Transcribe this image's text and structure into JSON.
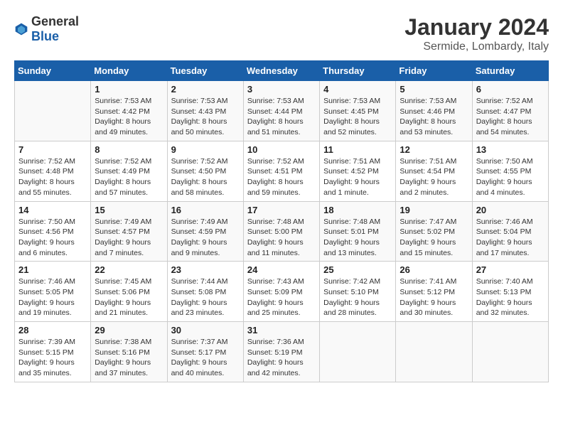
{
  "header": {
    "logo": {
      "general": "General",
      "blue": "Blue"
    },
    "month": "January 2024",
    "location": "Sermide, Lombardy, Italy"
  },
  "columns": [
    "Sunday",
    "Monday",
    "Tuesday",
    "Wednesday",
    "Thursday",
    "Friday",
    "Saturday"
  ],
  "weeks": [
    [
      {
        "day": "",
        "sunrise": "",
        "sunset": "",
        "daylight": ""
      },
      {
        "day": "1",
        "sunrise": "Sunrise: 7:53 AM",
        "sunset": "Sunset: 4:42 PM",
        "daylight": "Daylight: 8 hours and 49 minutes."
      },
      {
        "day": "2",
        "sunrise": "Sunrise: 7:53 AM",
        "sunset": "Sunset: 4:43 PM",
        "daylight": "Daylight: 8 hours and 50 minutes."
      },
      {
        "day": "3",
        "sunrise": "Sunrise: 7:53 AM",
        "sunset": "Sunset: 4:44 PM",
        "daylight": "Daylight: 8 hours and 51 minutes."
      },
      {
        "day": "4",
        "sunrise": "Sunrise: 7:53 AM",
        "sunset": "Sunset: 4:45 PM",
        "daylight": "Daylight: 8 hours and 52 minutes."
      },
      {
        "day": "5",
        "sunrise": "Sunrise: 7:53 AM",
        "sunset": "Sunset: 4:46 PM",
        "daylight": "Daylight: 8 hours and 53 minutes."
      },
      {
        "day": "6",
        "sunrise": "Sunrise: 7:52 AM",
        "sunset": "Sunset: 4:47 PM",
        "daylight": "Daylight: 8 hours and 54 minutes."
      }
    ],
    [
      {
        "day": "7",
        "sunrise": "Sunrise: 7:52 AM",
        "sunset": "Sunset: 4:48 PM",
        "daylight": "Daylight: 8 hours and 55 minutes."
      },
      {
        "day": "8",
        "sunrise": "Sunrise: 7:52 AM",
        "sunset": "Sunset: 4:49 PM",
        "daylight": "Daylight: 8 hours and 57 minutes."
      },
      {
        "day": "9",
        "sunrise": "Sunrise: 7:52 AM",
        "sunset": "Sunset: 4:50 PM",
        "daylight": "Daylight: 8 hours and 58 minutes."
      },
      {
        "day": "10",
        "sunrise": "Sunrise: 7:52 AM",
        "sunset": "Sunset: 4:51 PM",
        "daylight": "Daylight: 8 hours and 59 minutes."
      },
      {
        "day": "11",
        "sunrise": "Sunrise: 7:51 AM",
        "sunset": "Sunset: 4:52 PM",
        "daylight": "Daylight: 9 hours and 1 minute."
      },
      {
        "day": "12",
        "sunrise": "Sunrise: 7:51 AM",
        "sunset": "Sunset: 4:54 PM",
        "daylight": "Daylight: 9 hours and 2 minutes."
      },
      {
        "day": "13",
        "sunrise": "Sunrise: 7:50 AM",
        "sunset": "Sunset: 4:55 PM",
        "daylight": "Daylight: 9 hours and 4 minutes."
      }
    ],
    [
      {
        "day": "14",
        "sunrise": "Sunrise: 7:50 AM",
        "sunset": "Sunset: 4:56 PM",
        "daylight": "Daylight: 9 hours and 6 minutes."
      },
      {
        "day": "15",
        "sunrise": "Sunrise: 7:49 AM",
        "sunset": "Sunset: 4:57 PM",
        "daylight": "Daylight: 9 hours and 7 minutes."
      },
      {
        "day": "16",
        "sunrise": "Sunrise: 7:49 AM",
        "sunset": "Sunset: 4:59 PM",
        "daylight": "Daylight: 9 hours and 9 minutes."
      },
      {
        "day": "17",
        "sunrise": "Sunrise: 7:48 AM",
        "sunset": "Sunset: 5:00 PM",
        "daylight": "Daylight: 9 hours and 11 minutes."
      },
      {
        "day": "18",
        "sunrise": "Sunrise: 7:48 AM",
        "sunset": "Sunset: 5:01 PM",
        "daylight": "Daylight: 9 hours and 13 minutes."
      },
      {
        "day": "19",
        "sunrise": "Sunrise: 7:47 AM",
        "sunset": "Sunset: 5:02 PM",
        "daylight": "Daylight: 9 hours and 15 minutes."
      },
      {
        "day": "20",
        "sunrise": "Sunrise: 7:46 AM",
        "sunset": "Sunset: 5:04 PM",
        "daylight": "Daylight: 9 hours and 17 minutes."
      }
    ],
    [
      {
        "day": "21",
        "sunrise": "Sunrise: 7:46 AM",
        "sunset": "Sunset: 5:05 PM",
        "daylight": "Daylight: 9 hours and 19 minutes."
      },
      {
        "day": "22",
        "sunrise": "Sunrise: 7:45 AM",
        "sunset": "Sunset: 5:06 PM",
        "daylight": "Daylight: 9 hours and 21 minutes."
      },
      {
        "day": "23",
        "sunrise": "Sunrise: 7:44 AM",
        "sunset": "Sunset: 5:08 PM",
        "daylight": "Daylight: 9 hours and 23 minutes."
      },
      {
        "day": "24",
        "sunrise": "Sunrise: 7:43 AM",
        "sunset": "Sunset: 5:09 PM",
        "daylight": "Daylight: 9 hours and 25 minutes."
      },
      {
        "day": "25",
        "sunrise": "Sunrise: 7:42 AM",
        "sunset": "Sunset: 5:10 PM",
        "daylight": "Daylight: 9 hours and 28 minutes."
      },
      {
        "day": "26",
        "sunrise": "Sunrise: 7:41 AM",
        "sunset": "Sunset: 5:12 PM",
        "daylight": "Daylight: 9 hours and 30 minutes."
      },
      {
        "day": "27",
        "sunrise": "Sunrise: 7:40 AM",
        "sunset": "Sunset: 5:13 PM",
        "daylight": "Daylight: 9 hours and 32 minutes."
      }
    ],
    [
      {
        "day": "28",
        "sunrise": "Sunrise: 7:39 AM",
        "sunset": "Sunset: 5:15 PM",
        "daylight": "Daylight: 9 hours and 35 minutes."
      },
      {
        "day": "29",
        "sunrise": "Sunrise: 7:38 AM",
        "sunset": "Sunset: 5:16 PM",
        "daylight": "Daylight: 9 hours and 37 minutes."
      },
      {
        "day": "30",
        "sunrise": "Sunrise: 7:37 AM",
        "sunset": "Sunset: 5:17 PM",
        "daylight": "Daylight: 9 hours and 40 minutes."
      },
      {
        "day": "31",
        "sunrise": "Sunrise: 7:36 AM",
        "sunset": "Sunset: 5:19 PM",
        "daylight": "Daylight: 9 hours and 42 minutes."
      },
      {
        "day": "",
        "sunrise": "",
        "sunset": "",
        "daylight": ""
      },
      {
        "day": "",
        "sunrise": "",
        "sunset": "",
        "daylight": ""
      },
      {
        "day": "",
        "sunrise": "",
        "sunset": "",
        "daylight": ""
      }
    ]
  ]
}
